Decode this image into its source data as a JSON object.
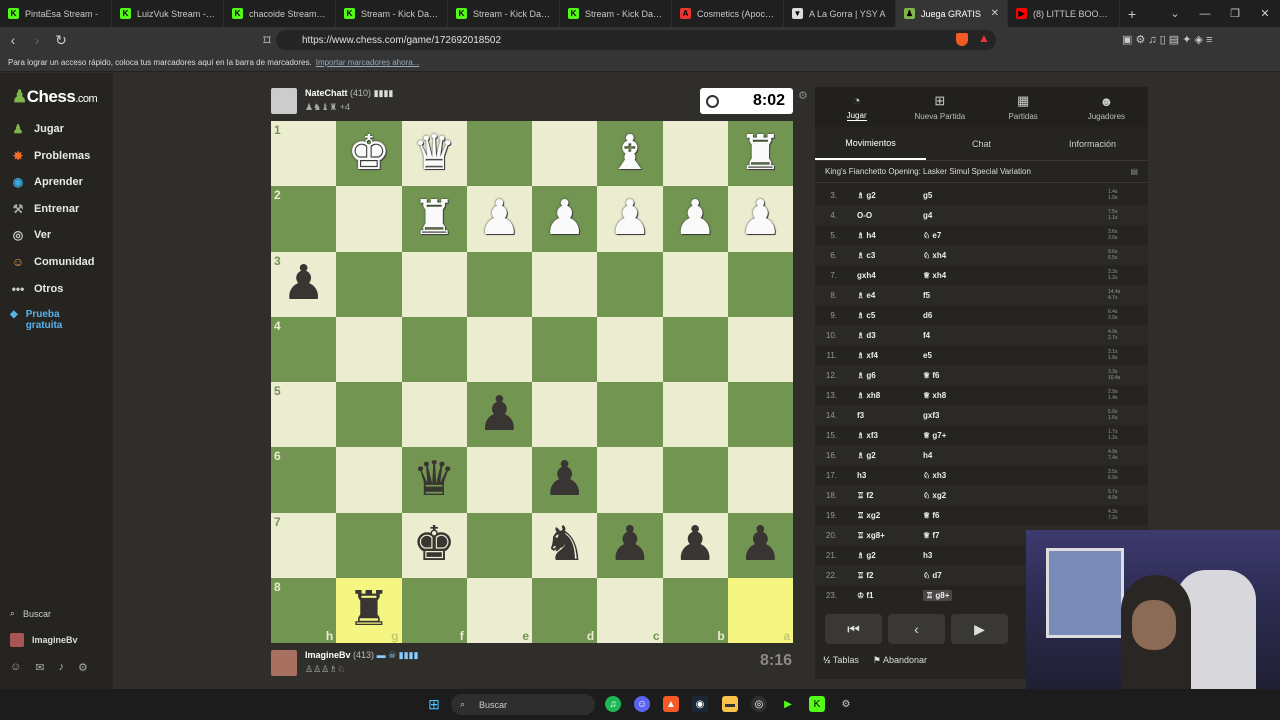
{
  "browser": {
    "tabs": [
      {
        "title": "PintaEsa Stream -",
        "favicon": "K",
        "color": "#53fc18"
      },
      {
        "title": "LuizVuk Stream - Wat",
        "favicon": "K",
        "color": "#53fc18"
      },
      {
        "title": "chacoide Stream - Wa",
        "favicon": "K",
        "color": "#53fc18"
      },
      {
        "title": "Stream - Kick Dashbo",
        "favicon": "K",
        "color": "#53fc18"
      },
      {
        "title": "Stream - Kick Dashbo",
        "favicon": "K",
        "color": "#53fc18"
      },
      {
        "title": "Stream - Kick Dashbo",
        "favicon": "K",
        "color": "#53fc18"
      },
      {
        "title": "Cosmetics (Apocalyp:",
        "favicon": "A",
        "color": "#e33"
      },
      {
        "title": "A La Gorra | YSY A",
        "favicon": "▼",
        "color": "#ddd"
      },
      {
        "title": "Juega GRATIS",
        "favicon": "♟",
        "color": "#81b64c",
        "active": true
      },
      {
        "title": "(8) LITTLE BOOGIE & I",
        "favicon": "▶",
        "color": "#f00"
      }
    ],
    "url": "https://www.chess.com/game/172692018502",
    "bookmarks_text": "Para lograr un acceso rápido, coloca tus marcadores aquí en la barra de marcadores.",
    "bookmarks_link": "Importar marcadores ahora..."
  },
  "sidebar": {
    "logo_text": "Chess",
    "logo_suffix": ".com",
    "items": [
      {
        "label": "Jugar",
        "icon": "board-icon",
        "glyph": "♟",
        "color": "#81b64c"
      },
      {
        "label": "Problemas",
        "icon": "puzzle-icon",
        "glyph": "✸",
        "color": "#f56f2a"
      },
      {
        "label": "Aprender",
        "icon": "learn-icon",
        "glyph": "◉",
        "color": "#3ea7dd"
      },
      {
        "label": "Entrenar",
        "icon": "train-icon",
        "glyph": "⚒",
        "color": "#aaa"
      },
      {
        "label": "Ver",
        "icon": "binoculars-icon",
        "glyph": "◎",
        "color": "#ccc"
      },
      {
        "label": "Comunidad",
        "icon": "community-icon",
        "glyph": "☺",
        "color": "#e8a54b"
      },
      {
        "label": "Otros",
        "icon": "more-icon",
        "glyph": "•••",
        "color": "#ccc"
      }
    ],
    "trial_label": "Prueba gratuita",
    "search_label": "Buscar",
    "username": "ImagineBv"
  },
  "game": {
    "top_player": {
      "name": "NateChatt",
      "rating": "(410)",
      "captured": "+4"
    },
    "bottom_player": {
      "name": "ImagineBv",
      "rating": "(413)"
    },
    "top_clock": "8:02",
    "bottom_clock": "8:16",
    "ranks": [
      "1",
      "2",
      "3",
      "4",
      "5",
      "6",
      "7",
      "8"
    ],
    "files": [
      "h",
      "g",
      "f",
      "e",
      "d",
      "c",
      "b",
      "a"
    ],
    "board": [
      [
        "",
        "wK",
        "wQ",
        "",
        "",
        "wB",
        "",
        "wR"
      ],
      [
        "",
        "",
        "wR",
        "wP",
        "wP",
        "wP",
        "wP",
        "wP"
      ],
      [
        "bP",
        "",
        "",
        "",
        "",
        "",
        "",
        ""
      ],
      [
        "",
        "",
        "",
        "",
        "",
        "",
        "",
        ""
      ],
      [
        "",
        "",
        "",
        "bP",
        "",
        "",
        "",
        ""
      ],
      [
        "",
        "",
        "bQ",
        "",
        "bP",
        "",
        "",
        ""
      ],
      [
        "",
        "",
        "bK",
        "",
        "bN",
        "bP",
        "bP",
        "bP"
      ],
      [
        "",
        "bR",
        "",
        "",
        "",
        "",
        "",
        ""
      ]
    ],
    "highlight": [
      [
        7,
        1
      ],
      [
        7,
        7
      ]
    ]
  },
  "panel": {
    "tabs": [
      {
        "label": "Jugar",
        "icon": "play-icon",
        "glyph": "◔"
      },
      {
        "label": "Nueva Partida",
        "icon": "new-game-icon",
        "glyph": "⊞"
      },
      {
        "label": "Partidas",
        "icon": "games-icon",
        "glyph": "▦"
      },
      {
        "label": "Jugadores",
        "icon": "players-icon",
        "glyph": "☻"
      }
    ],
    "subtabs": [
      "Movimientos",
      "Chat",
      "Información"
    ],
    "opening": "King's Fianchetto Opening: Lasker Simul Special Variation",
    "moves": [
      {
        "n": "3.",
        "w": "♗ g2",
        "b": "g5",
        "t1": "1.4s",
        "t2": "1.0s"
      },
      {
        "n": "4.",
        "w": "O-O",
        "b": "g4",
        "t1": "7.5s",
        "t2": "1.1s"
      },
      {
        "n": "5.",
        "w": "♗ h4",
        "b": "♘ e7",
        "t1": "3.6s",
        "t2": "3.0s"
      },
      {
        "n": "6.",
        "w": "♗ c3",
        "b": "♘ xh4",
        "t1": "9.6s",
        "t2": "6.5s"
      },
      {
        "n": "7.",
        "w": "gxh4",
        "b": "♕ xh4",
        "t1": "3.3s",
        "t2": "1.2s"
      },
      {
        "n": "8.",
        "w": "♗ e4",
        "b": "f5",
        "t1": "14.4s",
        "t2": "4.7s"
      },
      {
        "n": "9.",
        "w": "♗ c5",
        "b": "d6",
        "t1": "6.4s",
        "t2": "3.0s"
      },
      {
        "n": "10.",
        "w": "♗ d3",
        "b": "f4",
        "t1": "4.9s",
        "t2": "2.7s"
      },
      {
        "n": "11.",
        "w": "♗ xf4",
        "b": "e5",
        "t1": "3.1s",
        "t2": "1.8s"
      },
      {
        "n": "12.",
        "w": "♗ g6",
        "b": "♕ f6",
        "t1": "3.3s",
        "t2": "10.4s"
      },
      {
        "n": "13.",
        "w": "♗ xh8",
        "b": "♕ xh8",
        "t1": "2.9s",
        "t2": "1.4s"
      },
      {
        "n": "14.",
        "w": "f3",
        "b": "gxf3",
        "t1": "5.0s",
        "t2": "1.6s"
      },
      {
        "n": "15.",
        "w": "♗ xf3",
        "b": "♕ g7+",
        "t1": "1.7s",
        "t2": "1.2s"
      },
      {
        "n": "16.",
        "w": "♗ g2",
        "b": "h4",
        "t1": "4.9s",
        "t2": "7.4s"
      },
      {
        "n": "17.",
        "w": "h3",
        "b": "♘ xh3",
        "t1": "3.5s",
        "t2": "6.9s"
      },
      {
        "n": "18.",
        "w": "♖ f2",
        "b": "♘ xg2",
        "t1": "5.7s",
        "t2": "4.9s"
      },
      {
        "n": "19.",
        "w": "♖ xg2",
        "b": "♕ f6",
        "t1": "4.3s",
        "t2": "7.2s"
      },
      {
        "n": "20.",
        "w": "♖ xg8+",
        "b": "♕ f7",
        "t1": "",
        "t2": ""
      },
      {
        "n": "21.",
        "w": "♗ g2",
        "b": "h3",
        "t1": "",
        "t2": ""
      },
      {
        "n": "22.",
        "w": "♖ f2",
        "b": "♘ d7",
        "t1": "",
        "t2": ""
      },
      {
        "n": "23.",
        "w": "♔ f1",
        "b": "♖ g8+",
        "t1": "",
        "t2": "",
        "cur": true
      }
    ],
    "draw_label": "Tablas",
    "draw_prefix": "½",
    "resign_label": "Abandonar"
  },
  "taskbar": {
    "search_label": "Buscar"
  }
}
